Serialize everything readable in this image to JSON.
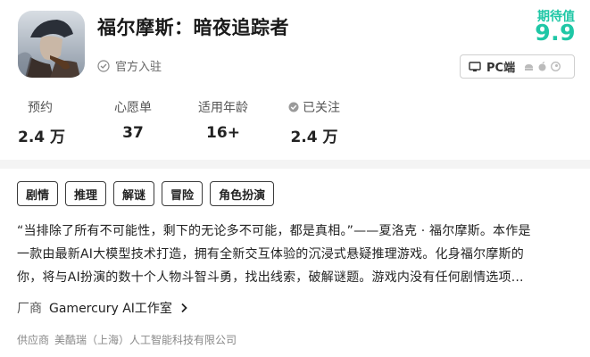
{
  "game": {
    "title": "福尔摩斯：暗夜追踪者",
    "official_label": "官方入驻",
    "expect_label": "期待值",
    "expect_score": "9.9"
  },
  "platform": {
    "label": "PC端",
    "icons": [
      "pc-icon",
      "android-icon",
      "apple-icon",
      "steam-icon"
    ]
  },
  "stats": [
    {
      "label": "预约",
      "value": "2.4 万"
    },
    {
      "label": "心愿单",
      "value": "37"
    },
    {
      "label": "适用年龄",
      "value": "16+"
    },
    {
      "label": "已关注",
      "value": "2.4 万"
    }
  ],
  "tags": [
    "剧情",
    "推理",
    "解谜",
    "冒险",
    "角色扮演"
  ],
  "description": {
    "lines": [
      "“当排除了所有不可能性，剩下的无论多不可能，都是真相。”——夏洛克 · 福尔摩斯。本作是",
      "一款由最新AI大模型技术打造，拥有全新交互体验的沉浸式悬疑推理游戏。化身福尔摩斯的",
      "你，将与AI扮演的数十个人物斗智斗勇，找出线索，破解谜题。游戏内没有任何剧情选项..."
    ]
  },
  "vendor": {
    "label": "厂商",
    "name": "Gamercury AI工作室"
  },
  "supplier": {
    "label": "供应商",
    "name": "美酷瑞（上海）人工智能科技有限公司"
  },
  "colors": {
    "accent": "#1fc7a6",
    "divider": "#f4f4f4"
  }
}
